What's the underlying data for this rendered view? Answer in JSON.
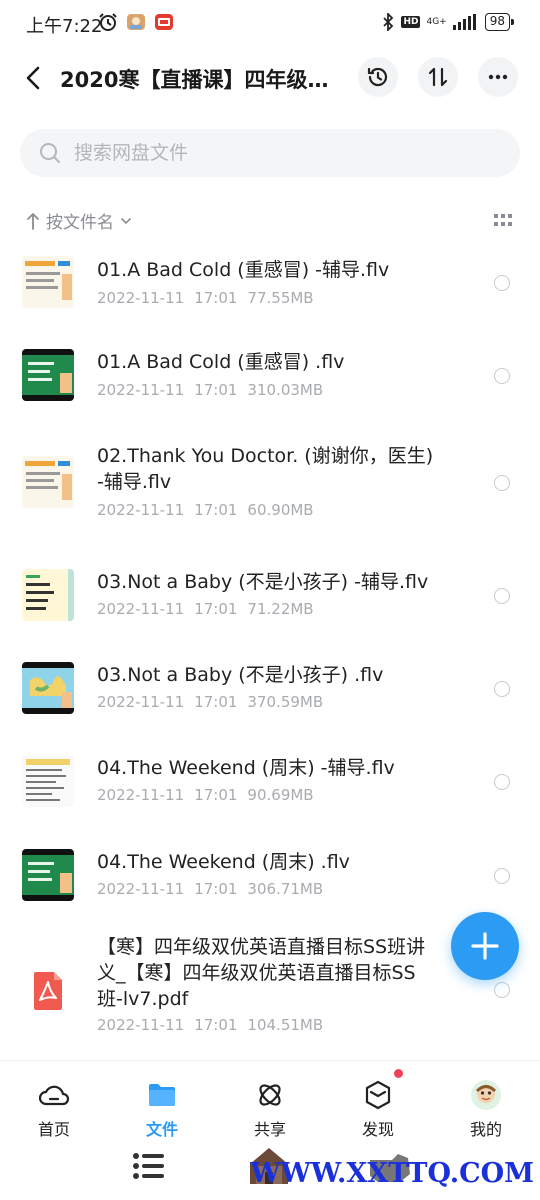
{
  "status_bar": {
    "time": "上午7:22",
    "net_type": "4G+",
    "battery": "98"
  },
  "header": {
    "title": "2020寒【直播课】四年级…",
    "back_icon": "back-arrow-icon",
    "history_icon": "history-icon",
    "sort_icon": "transfer-icon",
    "more_icon": "more-icon"
  },
  "search": {
    "placeholder": "搜索网盘文件"
  },
  "sort": {
    "label": "按文件名"
  },
  "files": [
    {
      "name": "01.A Bad Cold (重感冒) -辅导.flv",
      "date": "2022-11-11",
      "time": "17:01",
      "size": "77.55MB",
      "thumb": "tutor-light"
    },
    {
      "name": "01.A Bad Cold (重感冒) .flv",
      "date": "2022-11-11",
      "time": "17:01",
      "size": "310.03MB",
      "thumb": "green-board"
    },
    {
      "name": "02.Thank You Doctor. (谢谢你，医生) -辅导.flv",
      "date": "2022-11-11",
      "time": "17:01",
      "size": "60.90MB",
      "thumb": "tutor-light"
    },
    {
      "name": "03.Not a Baby (不是小孩子) -辅导.flv",
      "date": "2022-11-11",
      "time": "17:01",
      "size": "71.22MB",
      "thumb": "tutor-yellow"
    },
    {
      "name": "03.Not a Baby (不是小孩子) .flv",
      "date": "2022-11-11",
      "time": "17:01",
      "size": "370.59MB",
      "thumb": "map"
    },
    {
      "name": "04.The Weekend (周末) -辅导.flv",
      "date": "2022-11-11",
      "time": "17:01",
      "size": "90.69MB",
      "thumb": "tutor-text"
    },
    {
      "name": "04.The Weekend (周末) .flv",
      "date": "2022-11-11",
      "time": "17:01",
      "size": "306.71MB",
      "thumb": "green-board"
    },
    {
      "name": "【寒】四年级双优英语直播目标SS班讲义_【寒】四年级双优英语直播目标SS班-lv7.pdf",
      "date": "2022-11-11",
      "time": "17:01",
      "size": "104.51MB",
      "thumb": "pdf"
    }
  ],
  "nav": [
    {
      "label": "首页",
      "icon": "home-cloud-icon",
      "active": false
    },
    {
      "label": "文件",
      "icon": "folder-icon",
      "active": true
    },
    {
      "label": "共享",
      "icon": "share-atom-icon",
      "active": false
    },
    {
      "label": "发现",
      "icon": "discover-cube-icon",
      "active": false
    },
    {
      "label": "我的",
      "icon": "avatar-icon",
      "active": false
    }
  ],
  "watermark": "WWW.XXTTQ.COM",
  "colors": {
    "accent": "#2b9bf4",
    "badge": "#f0425a",
    "meta": "#a8abb0"
  }
}
